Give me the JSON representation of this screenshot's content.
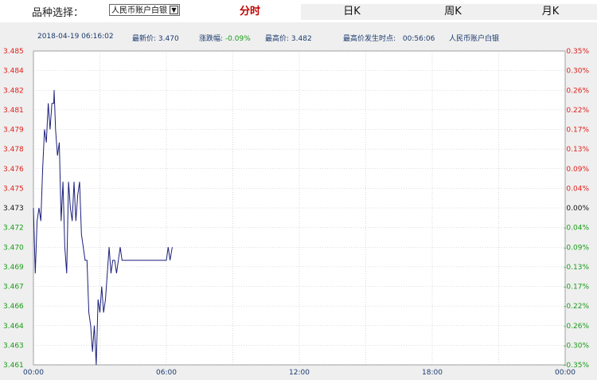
{
  "header": {
    "selector_label": "品种选择：",
    "selected_product": "人民币账户白银",
    "tabs": [
      {
        "label": "分时",
        "active": true
      },
      {
        "label": "日K",
        "active": false
      },
      {
        "label": "周K",
        "active": false
      },
      {
        "label": "月K",
        "active": false
      }
    ]
  },
  "info_bar": {
    "datetime": "2018-04-19 06:16:02",
    "latest_label": "最新价:",
    "latest_value": "3.470",
    "change_label": "涨跌幅:",
    "change_value": "-0.09%",
    "high_label": "最高价:",
    "high_value": "3.482",
    "high_time_label": "最高价发生时点:",
    "high_time_value": "00:56:06",
    "product_name": "人民币账户白银"
  },
  "colors": {
    "up": "#e0201b",
    "down": "#179c17",
    "neutral": "#111111",
    "line": "#1b1f7a",
    "grid": "#bfbfbf",
    "info_text": "#1a3a6e"
  },
  "chart_data": {
    "type": "line",
    "title": "",
    "xlabel": "",
    "ylabel": "",
    "x_ticks": [
      "00:00",
      "06:00",
      "12:00",
      "18:00",
      "00:00"
    ],
    "y_ticks_left": [
      "3.485",
      "3.484",
      "3.482",
      "3.481",
      "3.479",
      "3.478",
      "3.476",
      "3.475",
      "3.473",
      "3.472",
      "3.470",
      "3.469",
      "3.467",
      "3.466",
      "3.464",
      "3.463",
      "3.461"
    ],
    "y_ticks_right": [
      "0.35%",
      "0.30%",
      "0.26%",
      "0.22%",
      "0.17%",
      "0.13%",
      "0.09%",
      "0.04%",
      "0.00%",
      "-0.04%",
      "-0.09%",
      "-0.13%",
      "-0.17%",
      "-0.22%",
      "-0.26%",
      "-0.30%",
      "-0.35%"
    ],
    "ylim": [
      3.461,
      3.485
    ],
    "xlim_hours": [
      0,
      24
    ],
    "prev_close": 3.473,
    "grid": true,
    "series": [
      {
        "x_time": [
          "00:00",
          "00:05",
          "00:10",
          "00:15",
          "00:20",
          "00:25",
          "00:30",
          "00:35",
          "00:40",
          "00:45",
          "00:50",
          "00:55",
          "00:56",
          "01:00",
          "01:05",
          "01:10",
          "01:15",
          "01:20",
          "01:25",
          "01:30",
          "01:35",
          "01:40",
          "01:45",
          "01:50",
          "01:55",
          "02:00",
          "02:05",
          "02:10",
          "02:15",
          "02:20",
          "02:25",
          "02:30",
          "02:35",
          "02:40",
          "02:45",
          "02:50",
          "02:55",
          "03:00",
          "03:05",
          "03:10",
          "03:15",
          "03:20",
          "03:25",
          "03:30",
          "03:35",
          "03:40",
          "03:45",
          "03:50",
          "03:55",
          "04:00",
          "04:05",
          "04:10",
          "04:15",
          "04:20",
          "04:25",
          "04:30",
          "04:35",
          "04:40",
          "04:45",
          "04:50",
          "04:55",
          "05:00",
          "05:05",
          "05:10",
          "05:15",
          "05:20",
          "05:30",
          "05:40",
          "05:50",
          "06:00",
          "06:05",
          "06:10",
          "06:16"
        ],
        "y": [
          3.473,
          3.468,
          3.472,
          3.473,
          3.472,
          3.476,
          3.479,
          3.478,
          3.481,
          3.479,
          3.481,
          3.481,
          3.482,
          3.479,
          3.477,
          3.478,
          3.472,
          3.475,
          3.47,
          3.468,
          3.475,
          3.473,
          3.472,
          3.475,
          3.472,
          3.474,
          3.475,
          3.471,
          3.47,
          3.469,
          3.469,
          3.465,
          3.464,
          3.462,
          3.464,
          3.461,
          3.466,
          3.465,
          3.467,
          3.465,
          3.466,
          3.468,
          3.47,
          3.468,
          3.469,
          3.469,
          3.468,
          3.469,
          3.47,
          3.469,
          3.469,
          3.469,
          3.469,
          3.469,
          3.469,
          3.469,
          3.469,
          3.469,
          3.469,
          3.469,
          3.469,
          3.469,
          3.469,
          3.469,
          3.469,
          3.469,
          3.469,
          3.469,
          3.469,
          3.469,
          3.47,
          3.469,
          3.47
        ]
      }
    ]
  }
}
